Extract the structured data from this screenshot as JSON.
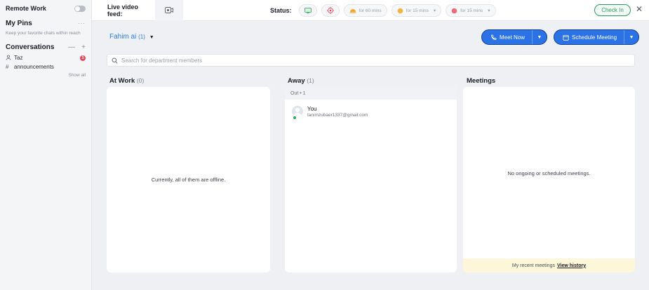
{
  "sidebar": {
    "title": "Remote Work",
    "pins_heading": "My Pins",
    "pins_hint": "Keep your favorite chats within reach",
    "conversations_heading": "Conversations",
    "items": [
      {
        "label": "Taz",
        "icon": "user-icon",
        "badge": "1"
      },
      {
        "label": "announcements",
        "icon": "hash-icon"
      }
    ],
    "show_all": "Show all"
  },
  "topbar": {
    "live_video_label": "Live video feed:",
    "status_label": "Status:",
    "pill_60": "for 60 mins",
    "pill_15a": "for 15 mins",
    "pill_15b": "for 15 mins",
    "check_in": "Check In",
    "close_glyph": "✕"
  },
  "main": {
    "user_name": "Fahim ai",
    "user_count": "(1)",
    "meet_now": "Meet Now",
    "schedule_meeting": "Schedule Meeting",
    "search_placeholder": "Search for department members",
    "columns": {
      "at_work": {
        "title": "At Work",
        "count": "(0)",
        "empty": "Currently, all of them are offline."
      },
      "away": {
        "title": "Away",
        "count": "(1)",
        "group": "Out • 1",
        "members": [
          {
            "name": "You",
            "email": "tanimzubaer1337@gmail.com"
          }
        ]
      },
      "meetings": {
        "title": "Meetings",
        "empty": "No ongoing or scheduled meetings.",
        "recent_label": "My recent meetings",
        "view_history": "View history"
      }
    }
  },
  "colors": {
    "accent": "#2b72e6",
    "check_in": "#2b9c5a",
    "badge": "#e24b5b",
    "recent_bg": "#fdf6d8"
  }
}
